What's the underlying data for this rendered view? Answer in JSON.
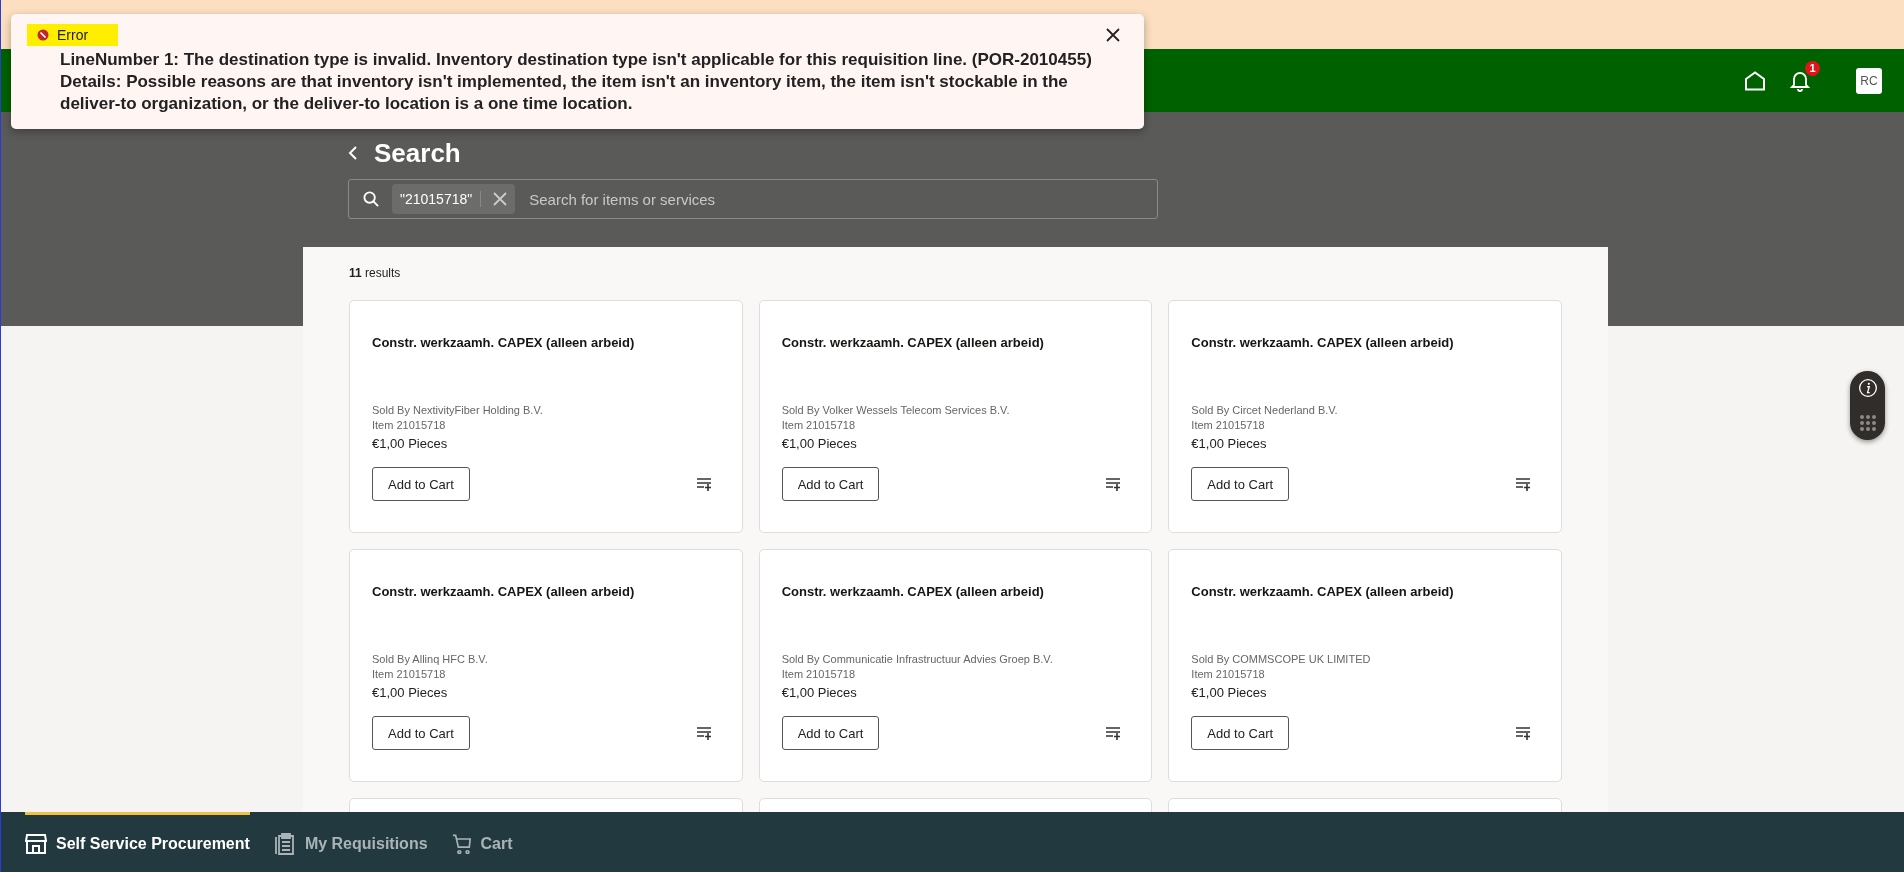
{
  "error": {
    "label": "Error",
    "message": "LineNumber 1: The destination type is invalid. Inventory destination type isn't applicable for this requisition line. (POR-2010455)\nDetails: Possible reasons are that inventory isn't implemented, the item isn't an inventory item, the item isn't stockable in the deliver-to organization, or the deliver-to location is a one time location."
  },
  "header": {
    "notification_count": "1",
    "avatar": "RC"
  },
  "page": {
    "title": "Search"
  },
  "search": {
    "chip": "\"21015718\"",
    "placeholder": "Search for items or services"
  },
  "results": {
    "count": "11",
    "label": "results"
  },
  "cards": [
    {
      "title": "Constr. werkzaamh. CAPEX (alleen arbeid)",
      "seller": "Sold By NextivityFiber Holding B.V.",
      "item": "Item 21015718",
      "price": "€1,00 Pieces",
      "button": "Add to Cart"
    },
    {
      "title": "Constr. werkzaamh. CAPEX (alleen arbeid)",
      "seller": "Sold By Volker Wessels Telecom Services B.V.",
      "item": "Item 21015718",
      "price": "€1,00 Pieces",
      "button": "Add to Cart"
    },
    {
      "title": "Constr. werkzaamh. CAPEX (alleen arbeid)",
      "seller": "Sold By Circet Nederland B.V.",
      "item": "Item 21015718",
      "price": "€1,00 Pieces",
      "button": "Add to Cart"
    },
    {
      "title": "Constr. werkzaamh. CAPEX (alleen arbeid)",
      "seller": "Sold By Allinq HFC B.V.",
      "item": "Item 21015718",
      "price": "€1,00 Pieces",
      "button": "Add to Cart"
    },
    {
      "title": "Constr. werkzaamh. CAPEX (alleen arbeid)",
      "seller": "Sold By Communicatie Infrastructuur Advies Groep B.V.",
      "item": "Item 21015718",
      "price": "€1,00 Pieces",
      "button": "Add to Cart"
    },
    {
      "title": "Constr. werkzaamh. CAPEX (alleen arbeid)",
      "seller": "Sold By COMMSCOPE UK LIMITED",
      "item": "Item 21015718",
      "price": "€1,00 Pieces",
      "button": "Add to Cart"
    }
  ],
  "bottom_nav": [
    {
      "label": "Self Service Procurement",
      "kind": "store",
      "selected": true
    },
    {
      "label": "My Requisitions",
      "kind": "clipboard",
      "selected": false
    },
    {
      "label": "Cart",
      "kind": "cart",
      "selected": false
    }
  ]
}
